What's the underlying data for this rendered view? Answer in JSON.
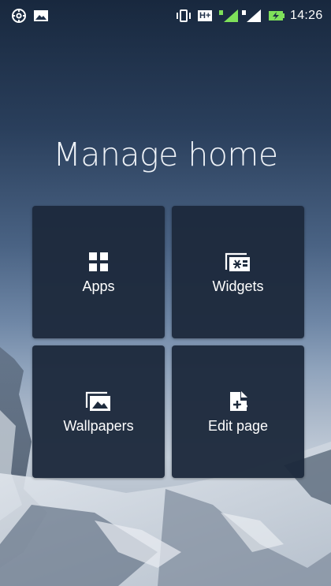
{
  "status_bar": {
    "time": "14:26",
    "network_type": "H+",
    "icons": [
      "settings-icon",
      "image-notification-icon",
      "vibrate-icon",
      "network-h-plus-icon",
      "signal-sim1-icon",
      "signal-sim2-icon",
      "battery-charging-icon"
    ]
  },
  "title": "Manage home",
  "tiles": [
    {
      "label": "Apps",
      "icon": "apps-grid-icon"
    },
    {
      "label": "Widgets",
      "icon": "widgets-icon"
    },
    {
      "label": "Wallpapers",
      "icon": "wallpapers-icon"
    },
    {
      "label": "Edit page",
      "icon": "edit-page-icon"
    }
  ],
  "colors": {
    "tile_background": "#1d2a3c",
    "text": "#ffffff",
    "signal_accent": "#7ee05a"
  }
}
